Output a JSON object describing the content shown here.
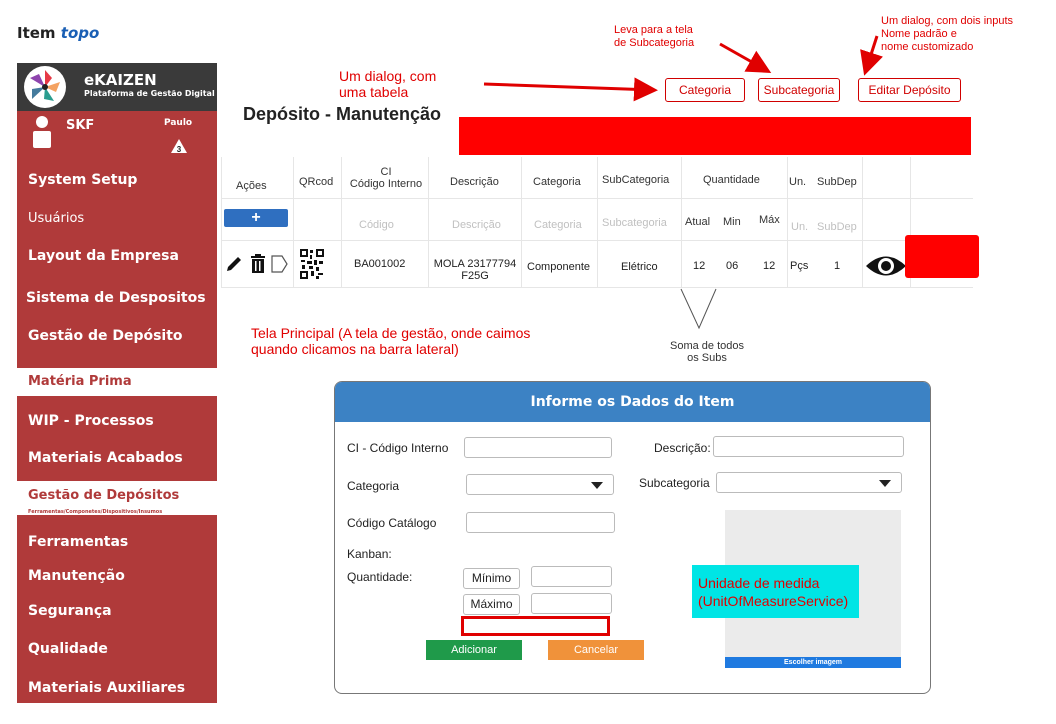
{
  "heading": {
    "label": "Item",
    "link": "topo"
  },
  "sidebar": {
    "brand_name": "eKAIZEN",
    "brand_sub": "Plataforma de Gestão Digital",
    "company": "SKF",
    "user": "Paulo",
    "badge": "3",
    "items": [
      {
        "label": "System Setup"
      },
      {
        "label": "Usuários"
      },
      {
        "label": "Layout da Empresa"
      },
      {
        "label": "Sistema de Despositos"
      },
      {
        "label": "Gestão de Depósito"
      },
      {
        "label": "Matéria Prima"
      },
      {
        "label": "WIP - Processos"
      },
      {
        "label": "Materiais Acabados"
      },
      {
        "label": "Gestão de Depósitos",
        "sub": "Ferramentas/Componetes/Dispositivos/Insumos"
      },
      {
        "label": "Ferramentas"
      },
      {
        "label": "Manutenção"
      },
      {
        "label": "Segurança"
      },
      {
        "label": "Qualidade"
      },
      {
        "label": "Materiais Auxiliares"
      }
    ]
  },
  "page": {
    "title": "Depósito - Manutenção"
  },
  "toolbar": {
    "categoria": "Categoria",
    "subcategoria": "Subcategoria",
    "editar": "Editar Depósito"
  },
  "annotations": {
    "dialog_table": [
      "Um dialog, com",
      "uma tabela"
    ],
    "leva": [
      "Leva para a tela",
      "de Subcategoria"
    ],
    "dialog_inputs": [
      "Um dialog, com dois inputs",
      "Nome padrão e",
      "nome customizado"
    ],
    "tela_principal": [
      "Tela Principal (A tela de gestão, onde caimos",
      "quando clicamos na barra lateral)"
    ],
    "soma": [
      "Soma de todos",
      "os Subs"
    ],
    "unidade": [
      "Unidade de medida",
      "(UnitOfMeasureService)"
    ]
  },
  "table": {
    "headers": {
      "acoes": "Ações",
      "qrcod": "QRcod",
      "ci_top": "CI",
      "ci_bottom": "Código Interno",
      "descricao": "Descrição",
      "categoria": "Categoria",
      "subcategoria": "SubCategoria",
      "quantidade": "Quantidade",
      "atual": "Atual",
      "min": "Min",
      "max": "Máx",
      "un": "Un.",
      "subdep": "SubDep"
    },
    "placeholders": {
      "codigo": "Código",
      "descricao": "Descrição",
      "categoria": "Categoria",
      "subcategoria": "Subcategoria",
      "un": "Un.",
      "subdep": "SubDep"
    },
    "add_label": "+",
    "row": {
      "ci": "BA001002",
      "desc_line1": "MOLA 23177794",
      "desc_line2": "F25G",
      "categoria": "Componente",
      "subcategoria": "Elétrico",
      "atual": "12",
      "min": "06",
      "max": "12",
      "un": "Pçs",
      "subdep": "1"
    }
  },
  "dialog": {
    "title": "Informe os Dados do Item",
    "ci_label": "CI - Código Interno",
    "descricao_label": "Descrição:",
    "categoria_label": "Categoria",
    "subcategoria_label": "Subcategoria",
    "catalogo_label": "Código Catálogo",
    "kanban_label": "Kanban:",
    "quantidade_label": "Quantidade:",
    "minimo": "Mínimo",
    "maximo": "Máximo",
    "image_button": "Escolher imagem",
    "adicionar": "Adicionar",
    "cancelar": "Cancelar"
  },
  "colors": {
    "sidebar": "#b03a3a",
    "brand": "#3a3a3a",
    "dialog_header": "#3c82c4",
    "add_button": "#2f6fc0",
    "adicionar": "#1f9a4a",
    "cancelar": "#f0923a",
    "annotation": "#e00000",
    "highlight": "#00e5e5"
  }
}
